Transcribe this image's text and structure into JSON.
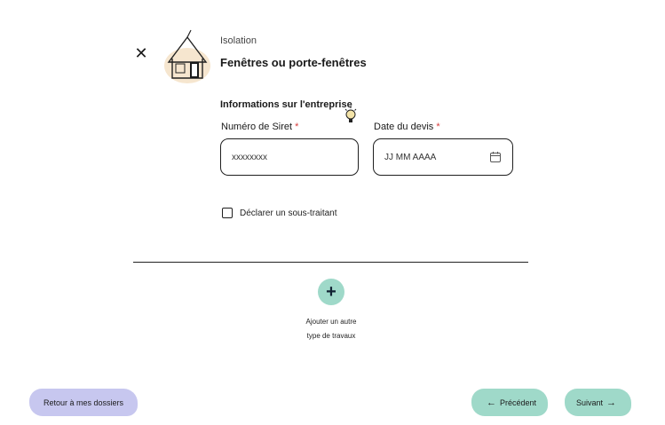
{
  "header": {
    "close_icon": "close-icon",
    "category": "Isolation",
    "subcategory": "Fenêtres ou porte-fenêtres"
  },
  "section": {
    "title": "Informations sur l'entreprise"
  },
  "siret": {
    "label": "Numéro de Siret",
    "required_mark": "*",
    "value": "xxxxxxxx"
  },
  "date": {
    "label": "Date du devis",
    "required_mark": "*",
    "placeholder": "JJ MM AAAA"
  },
  "subcontractor": {
    "label": "Déclarer un sous-traitant",
    "checked": false
  },
  "add_work": {
    "line1": "Ajouter un autre",
    "line2": "type de travaux"
  },
  "footer": {
    "back_label": "Retour à mes dossiers",
    "prev_label": "Précédent",
    "next_label": "Suivant"
  },
  "colors": {
    "accent_green": "#9fd9c9",
    "accent_lavender": "#c7c7ef",
    "required_red": "#d63c3c"
  }
}
